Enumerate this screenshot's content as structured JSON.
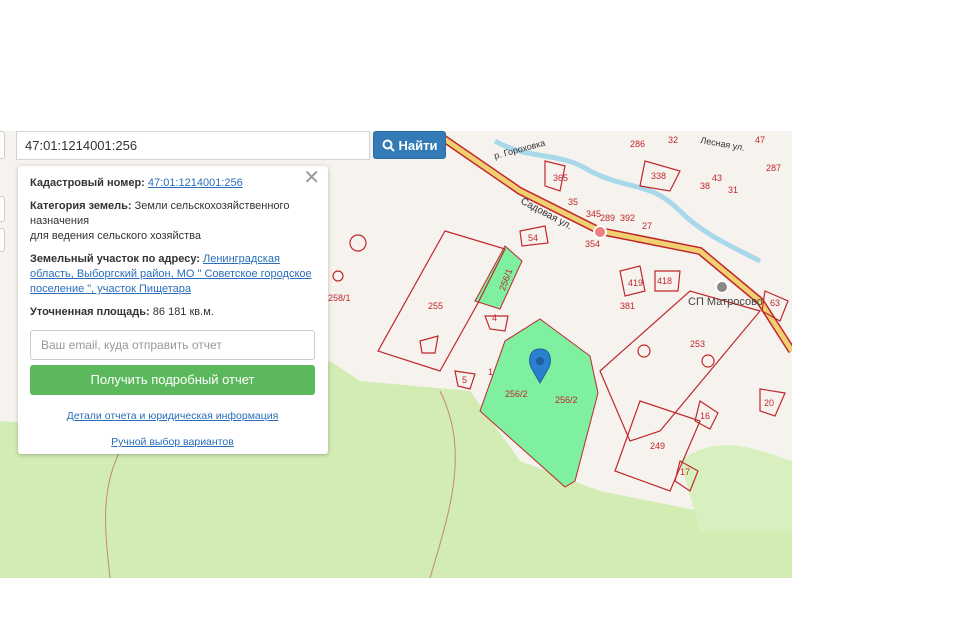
{
  "search": {
    "value": "47:01:1214001:256",
    "button_label": "Найти"
  },
  "panel": {
    "close_glyph": "✕",
    "cadastral_label": "Кадастровый номер:",
    "cadastral_value": "47:01:1214001:256",
    "category_label": "Категория земель:",
    "category_value": "Земли сельскохозяйственного назначения",
    "category_use": "для ведения сельского хозяйства",
    "address_label": "Земельный участок по адресу:",
    "address_value": "Ленинградская область, Выборгский район, МО \" Советское городское поселение \", участок Пищетара",
    "area_label": "Уточненная площадь:",
    "area_value": "86 181 кв.м.",
    "email_placeholder": "Ваш email, куда отправить отчет",
    "report_button": "Получить подробный отчет",
    "details_link": "Детали отчета и юридическая информация",
    "manual_link": "Ручной выбор вариантов"
  },
  "map": {
    "labels": {
      "road": "Садовая ул.",
      "river": "р. Гороховка",
      "settlement": "СП Матросово",
      "street_top": "Лесная ул."
    },
    "parcels": [
      "255",
      "256/1",
      "256/2",
      "256/2",
      "258/1",
      "4",
      "5",
      "1",
      "54",
      "253",
      "249",
      "20",
      "16",
      "17",
      "63",
      "418",
      "419",
      "381",
      "338",
      "365",
      "35",
      "345",
      "289",
      "392",
      "27",
      "354",
      "286",
      "32",
      "47",
      "43",
      "31",
      "38",
      "287"
    ],
    "colors": {
      "selected_parcel": "#7ef0a0",
      "parcel_border": "#c0272d",
      "forest": "#d2ecb4",
      "road": "#f0d070",
      "river": "#a8d8ea",
      "marker": "#2a7fcf"
    }
  }
}
